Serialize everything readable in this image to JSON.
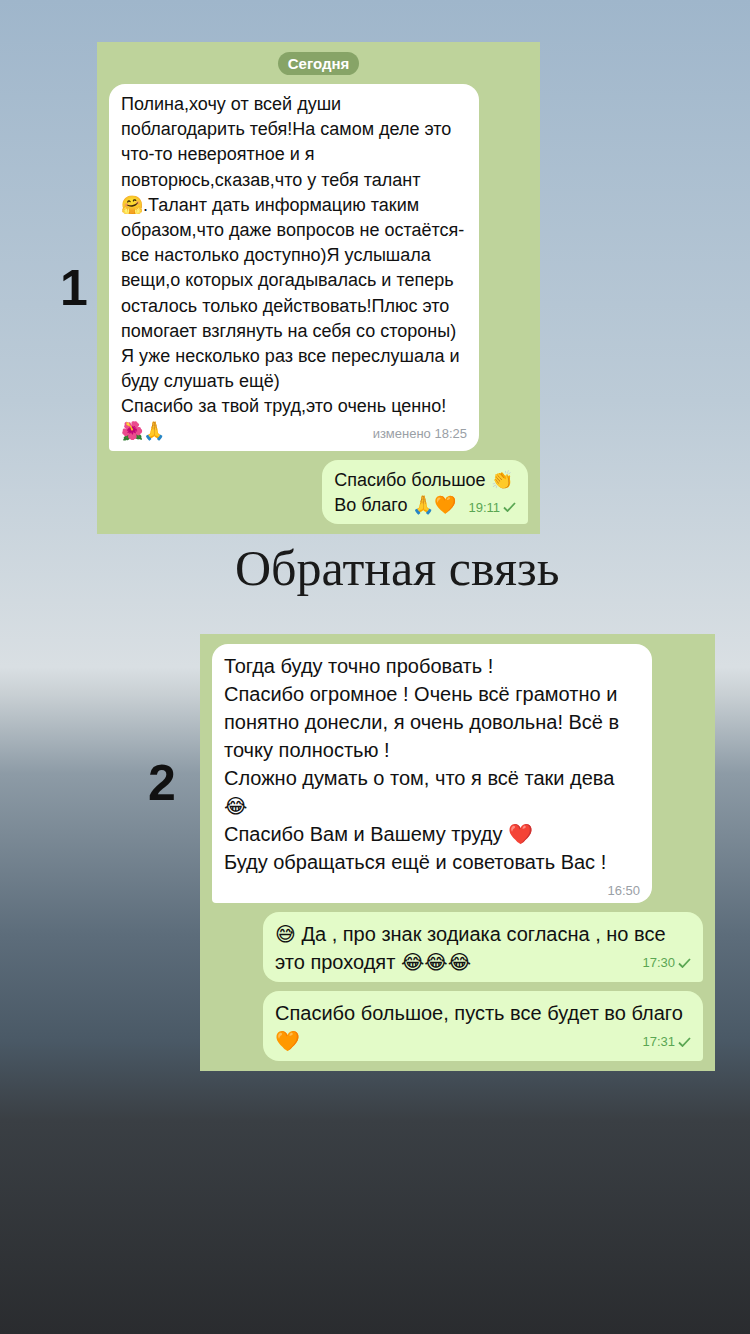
{
  "title": "Обратная связь",
  "chats": [
    {
      "number": "1",
      "date": "Сегодня",
      "messages": [
        {
          "direction": "in",
          "text": "Полина,хочу от всей души поблагодарить тебя!На самом деле это что-то невероятное и я повторюсь,сказав,что у тебя талант 🤗.Талант дать информацию таким образом,что даже вопросов не остаётся-все настолько доступно)Я услышала вещи,о которых догадывалась и теперь осталось только действовать!Плюс это помогает взглянуть на себя со стороны)\nЯ уже несколько раз все переслушала и буду слушать ещё)\nСпасибо за твой труд,это очень ценно!🌺🙏",
          "time": "изменено 18:25",
          "sent": false
        },
        {
          "direction": "out",
          "text": "Спасибо большое 👏\nВо благо 🙏🧡",
          "time": "19:11",
          "sent": true
        }
      ]
    },
    {
      "number": "2",
      "date": "",
      "messages": [
        {
          "direction": "in",
          "text": "Тогда буду точно пробовать !\nСпасибо огромное ! Очень всё грамотно и понятно донесли, я очень довольна! Всё в точку полностью !\nСложно думать о том, что я всё таки дева 😂\nСпасибо Вам и Вашему труду ❤️\nБуду обращаться ещё и советовать Вас !",
          "time": "16:50",
          "sent": false
        },
        {
          "direction": "out",
          "text": "😅 Да , про знак зодиака согласна , но все это проходят 😂😂😂",
          "time": "17:30",
          "sent": true
        },
        {
          "direction": "out",
          "text": "Спасибо большое, пусть все будет во благо 🧡",
          "time": "17:31",
          "sent": true
        }
      ]
    }
  ]
}
